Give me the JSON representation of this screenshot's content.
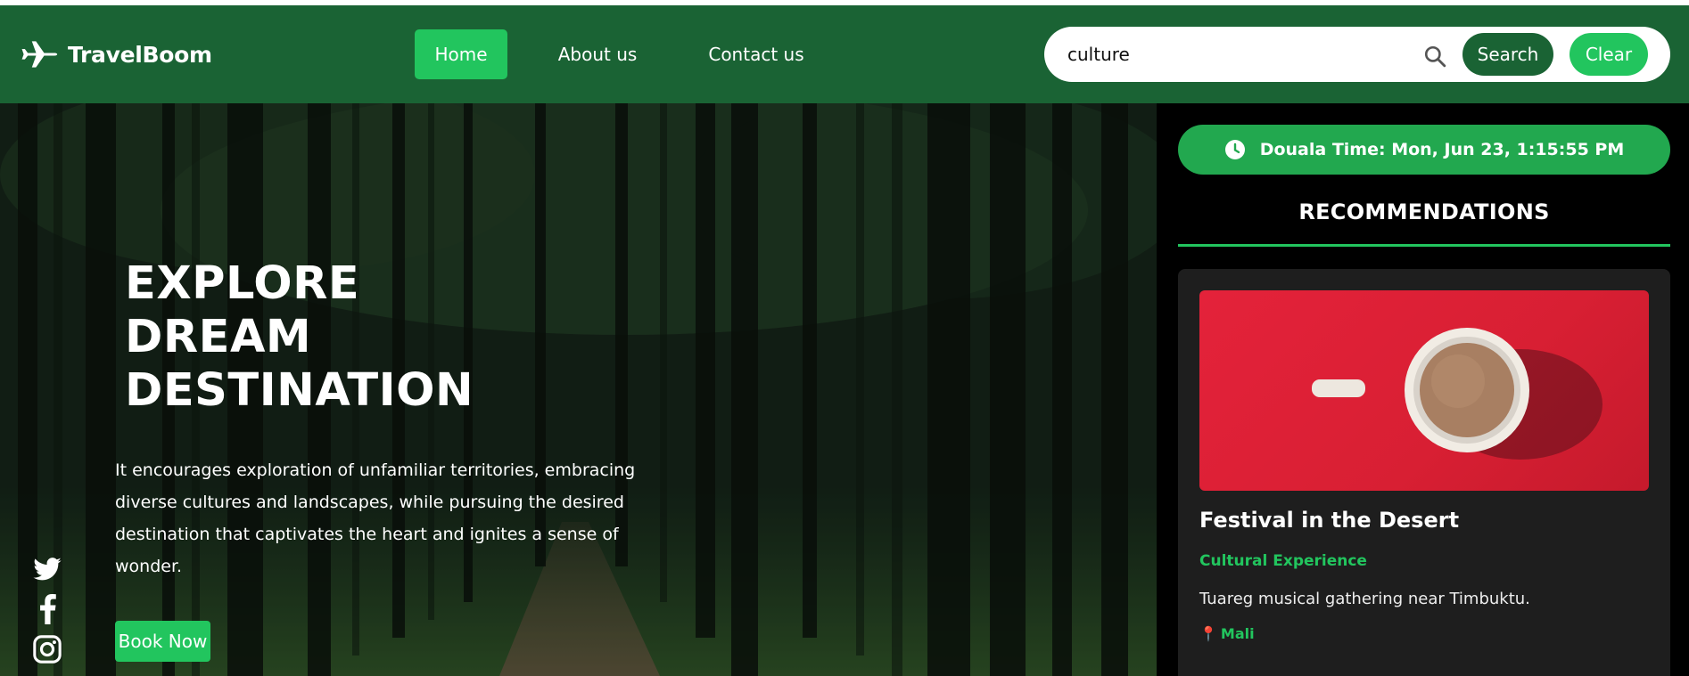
{
  "brand": {
    "name": "TravelBoom",
    "icon": "airplane-icon"
  },
  "nav": {
    "items": [
      {
        "label": "Home",
        "active": true
      },
      {
        "label": "About us",
        "active": false
      },
      {
        "label": "Contact us",
        "active": false
      }
    ]
  },
  "search": {
    "value": "culture",
    "search_label": "Search",
    "clear_label": "Clear",
    "icon": "search-icon"
  },
  "hero": {
    "title_lines": [
      "EXPLORE",
      "DREAM",
      "DESTINATION"
    ],
    "description": "It encourages exploration of unfamiliar territories, embracing diverse cultures and landscapes, while pursuing the desired destination that captivates the heart and ignites a sense of wonder.",
    "book_label": "Book Now",
    "social": [
      "twitter-icon",
      "facebook-icon",
      "instagram-icon"
    ]
  },
  "sidebar": {
    "time": "Douala Time: Mon, Jun 23, 1:15:55 PM",
    "heading": "RECOMMENDATIONS",
    "card": {
      "title": "Festival in the Desert",
      "category": "Cultural Experience",
      "description": "Tuareg musical gathering near Timbuktu.",
      "location": "Mali"
    }
  },
  "colors": {
    "nav_bg": "#1a6334",
    "accent": "#22c55e",
    "card_bg": "#1e1e1e"
  }
}
